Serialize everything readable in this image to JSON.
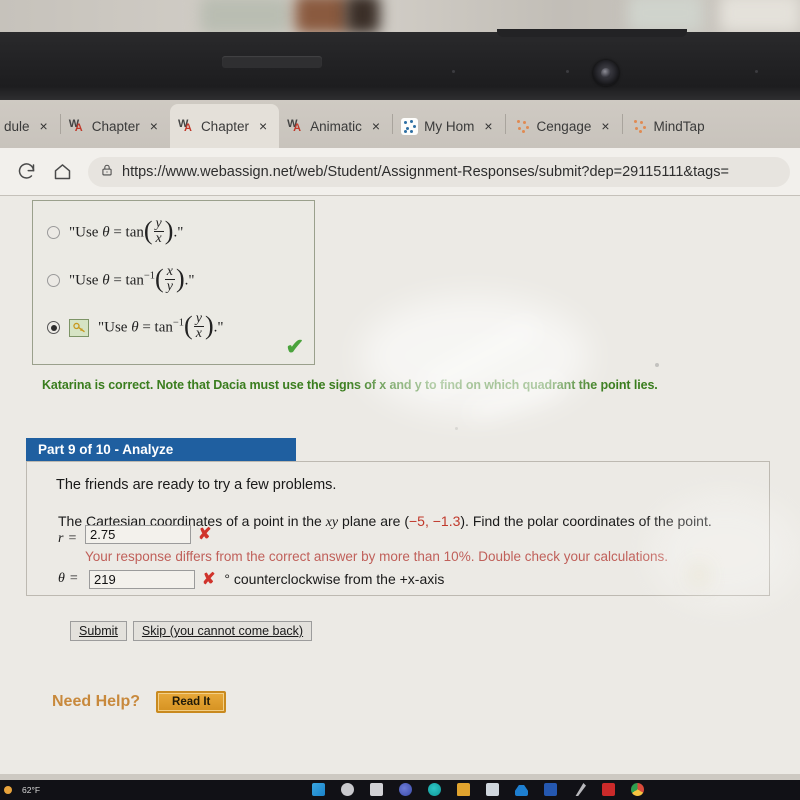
{
  "browser": {
    "tabs": [
      {
        "label": "dule",
        "favicon": "none",
        "active": false,
        "close": "×"
      },
      {
        "label": "Chapter",
        "favicon": "webassign-icon",
        "active": false,
        "close": "×"
      },
      {
        "label": "Chapter",
        "favicon": "webassign-icon",
        "active": true,
        "close": "×"
      },
      {
        "label": "Animatic",
        "favicon": "webassign-icon",
        "active": false,
        "close": "×"
      },
      {
        "label": "My Hom",
        "favicon": "cengage-blue-icon",
        "active": false,
        "close": "×"
      },
      {
        "label": "Cengage",
        "favicon": "cengage-orange-icon",
        "active": false,
        "close": "×"
      },
      {
        "label": "MindTap",
        "favicon": "cengage-orange-icon",
        "active": false,
        "close": "×"
      }
    ],
    "toolbar": {
      "reload_icon": "reload-icon",
      "home_icon": "home-icon",
      "lock_icon": "lock-icon",
      "url": "https://www.webassign.net/web/Student/Assignment-Responses/submit?dep=29115111&tags="
    }
  },
  "quiz": {
    "options": [
      {
        "id": "opt-1",
        "selected": false,
        "has_key_badge": false,
        "text_prefix": "\"Use ",
        "theta": "θ",
        "eq": " = ",
        "fn": "tan",
        "inverse": false,
        "num": "y",
        "den": "x",
        "suffix": ".\""
      },
      {
        "id": "opt-2",
        "selected": false,
        "has_key_badge": false,
        "text_prefix": "\"Use ",
        "theta": "θ",
        "eq": " = ",
        "fn": "tan",
        "inverse": true,
        "num": "x",
        "den": "y",
        "suffix": ".\""
      },
      {
        "id": "opt-3",
        "selected": true,
        "has_key_badge": true,
        "text_prefix": "\"Use ",
        "theta": "θ",
        "eq": " = ",
        "fn": "tan",
        "inverse": true,
        "num": "y",
        "den": "x",
        "suffix": ".\""
      }
    ],
    "correct_check": "✔",
    "feedback": "Katarina is correct. Note that Dacia must use the signs of x and y to find on which quadrant the point lies.",
    "feedback_color": "#3a7d1e"
  },
  "part": {
    "header": "Part 9 of 10 - Analyze",
    "header_color": "#1f5fa0",
    "intro": "The friends are ready to try a few problems.",
    "problem_pre": "The Cartesian coordinates of a point in the ",
    "problem_xy": "xy",
    "problem_mid": " plane are (",
    "problem_coords": "−5, −1.3",
    "problem_post": "). Find the polar coordinates of the point.",
    "answers": [
      {
        "label": "r",
        "eq": "=",
        "value": "2.75",
        "status_icon": "wrong-x-icon",
        "status": "✘"
      },
      {
        "label": "θ",
        "eq": "=",
        "value": "219",
        "status_icon": "wrong-x-icon",
        "status": "✘",
        "note": "° counterclockwise from the +x-axis"
      }
    ],
    "error_message": "Your response differs from the correct answer by more than 10%. Double check your calculations.",
    "error_color": "#c0605a",
    "buttons": {
      "submit": "Submit",
      "skip": "Skip (you cannot come back)"
    }
  },
  "help": {
    "label": "Need Help?",
    "button": "Read It",
    "button_color": "#d59222"
  },
  "taskbar": {
    "weather": "62°F",
    "icons": [
      "start-windows-icon",
      "search-icon",
      "task-view-icon",
      "edge-icon",
      "teams-icon",
      "file-explorer-icon",
      "store-icon",
      "onedrive-icon",
      "word-icon",
      "snip-icon",
      "pdf-icon",
      "chrome-icon"
    ]
  },
  "hardware": {
    "webcam": "webcam-icon",
    "bezel_slot": "speaker-slot"
  }
}
